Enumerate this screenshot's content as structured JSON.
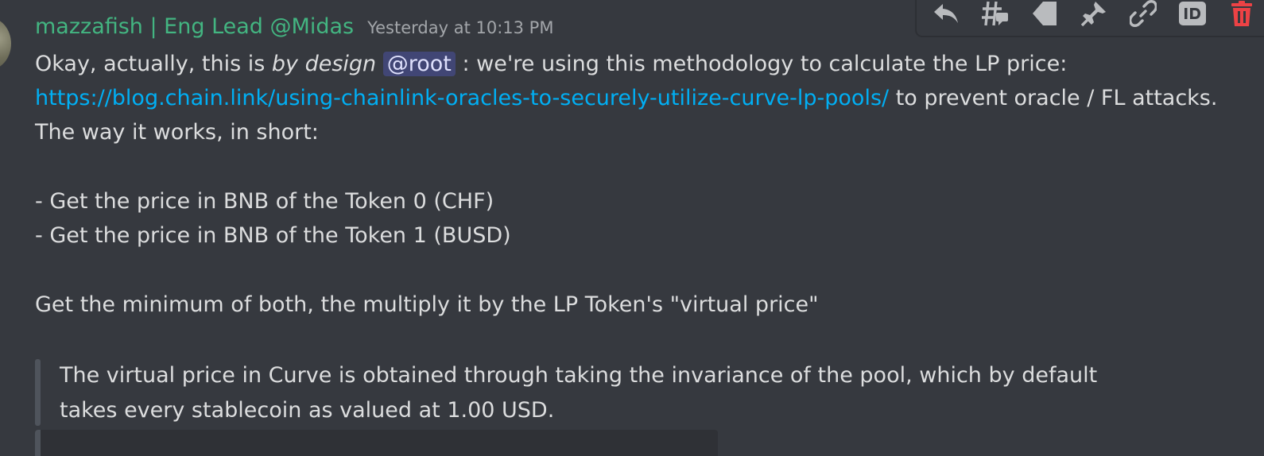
{
  "message": {
    "author": "mazzafish | Eng Lead @Midas",
    "timestamp": "Yesterday at 10:13 PM",
    "line1_before": "Okay, actually, this is ",
    "line1_italic": "by design",
    "line1_mention": "@root",
    "line1_after": " : we're using this methodology to calculate the LP price:",
    "link_text": "https://blog.chain.link/using-chainlink-oracles-to-securely-utilize-curve-lp-pools/",
    "line2_after": " to prevent oracle / FL attacks.",
    "line3": "The way it works, in short:",
    "bullet1": "- Get the price in BNB of the Token 0 (CHF)",
    "bullet2": "- Get the price in BNB of the Token 1 (BUSD)",
    "line6": "Get the minimum of both, the multiply it by the LP Token's \"virtual price\"",
    "quote_line1": "The virtual price in Curve is obtained through taking the invariance of the pool, which by default",
    "quote_line2": "takes every stablecoin as valued at 1.00 USD."
  },
  "toolbar": {
    "icons": [
      "reply-icon",
      "create-thread-icon",
      "tag-icon",
      "pin-icon",
      "copy-link-icon",
      "copy-id-icon",
      "delete-icon"
    ]
  },
  "colors": {
    "background": "#36393f",
    "username": "#43b581",
    "timestamp": "#a3a6aa",
    "text": "#dcddde",
    "link": "#00aff4",
    "mention_bg": "#414675",
    "delete": "#ed4245"
  }
}
